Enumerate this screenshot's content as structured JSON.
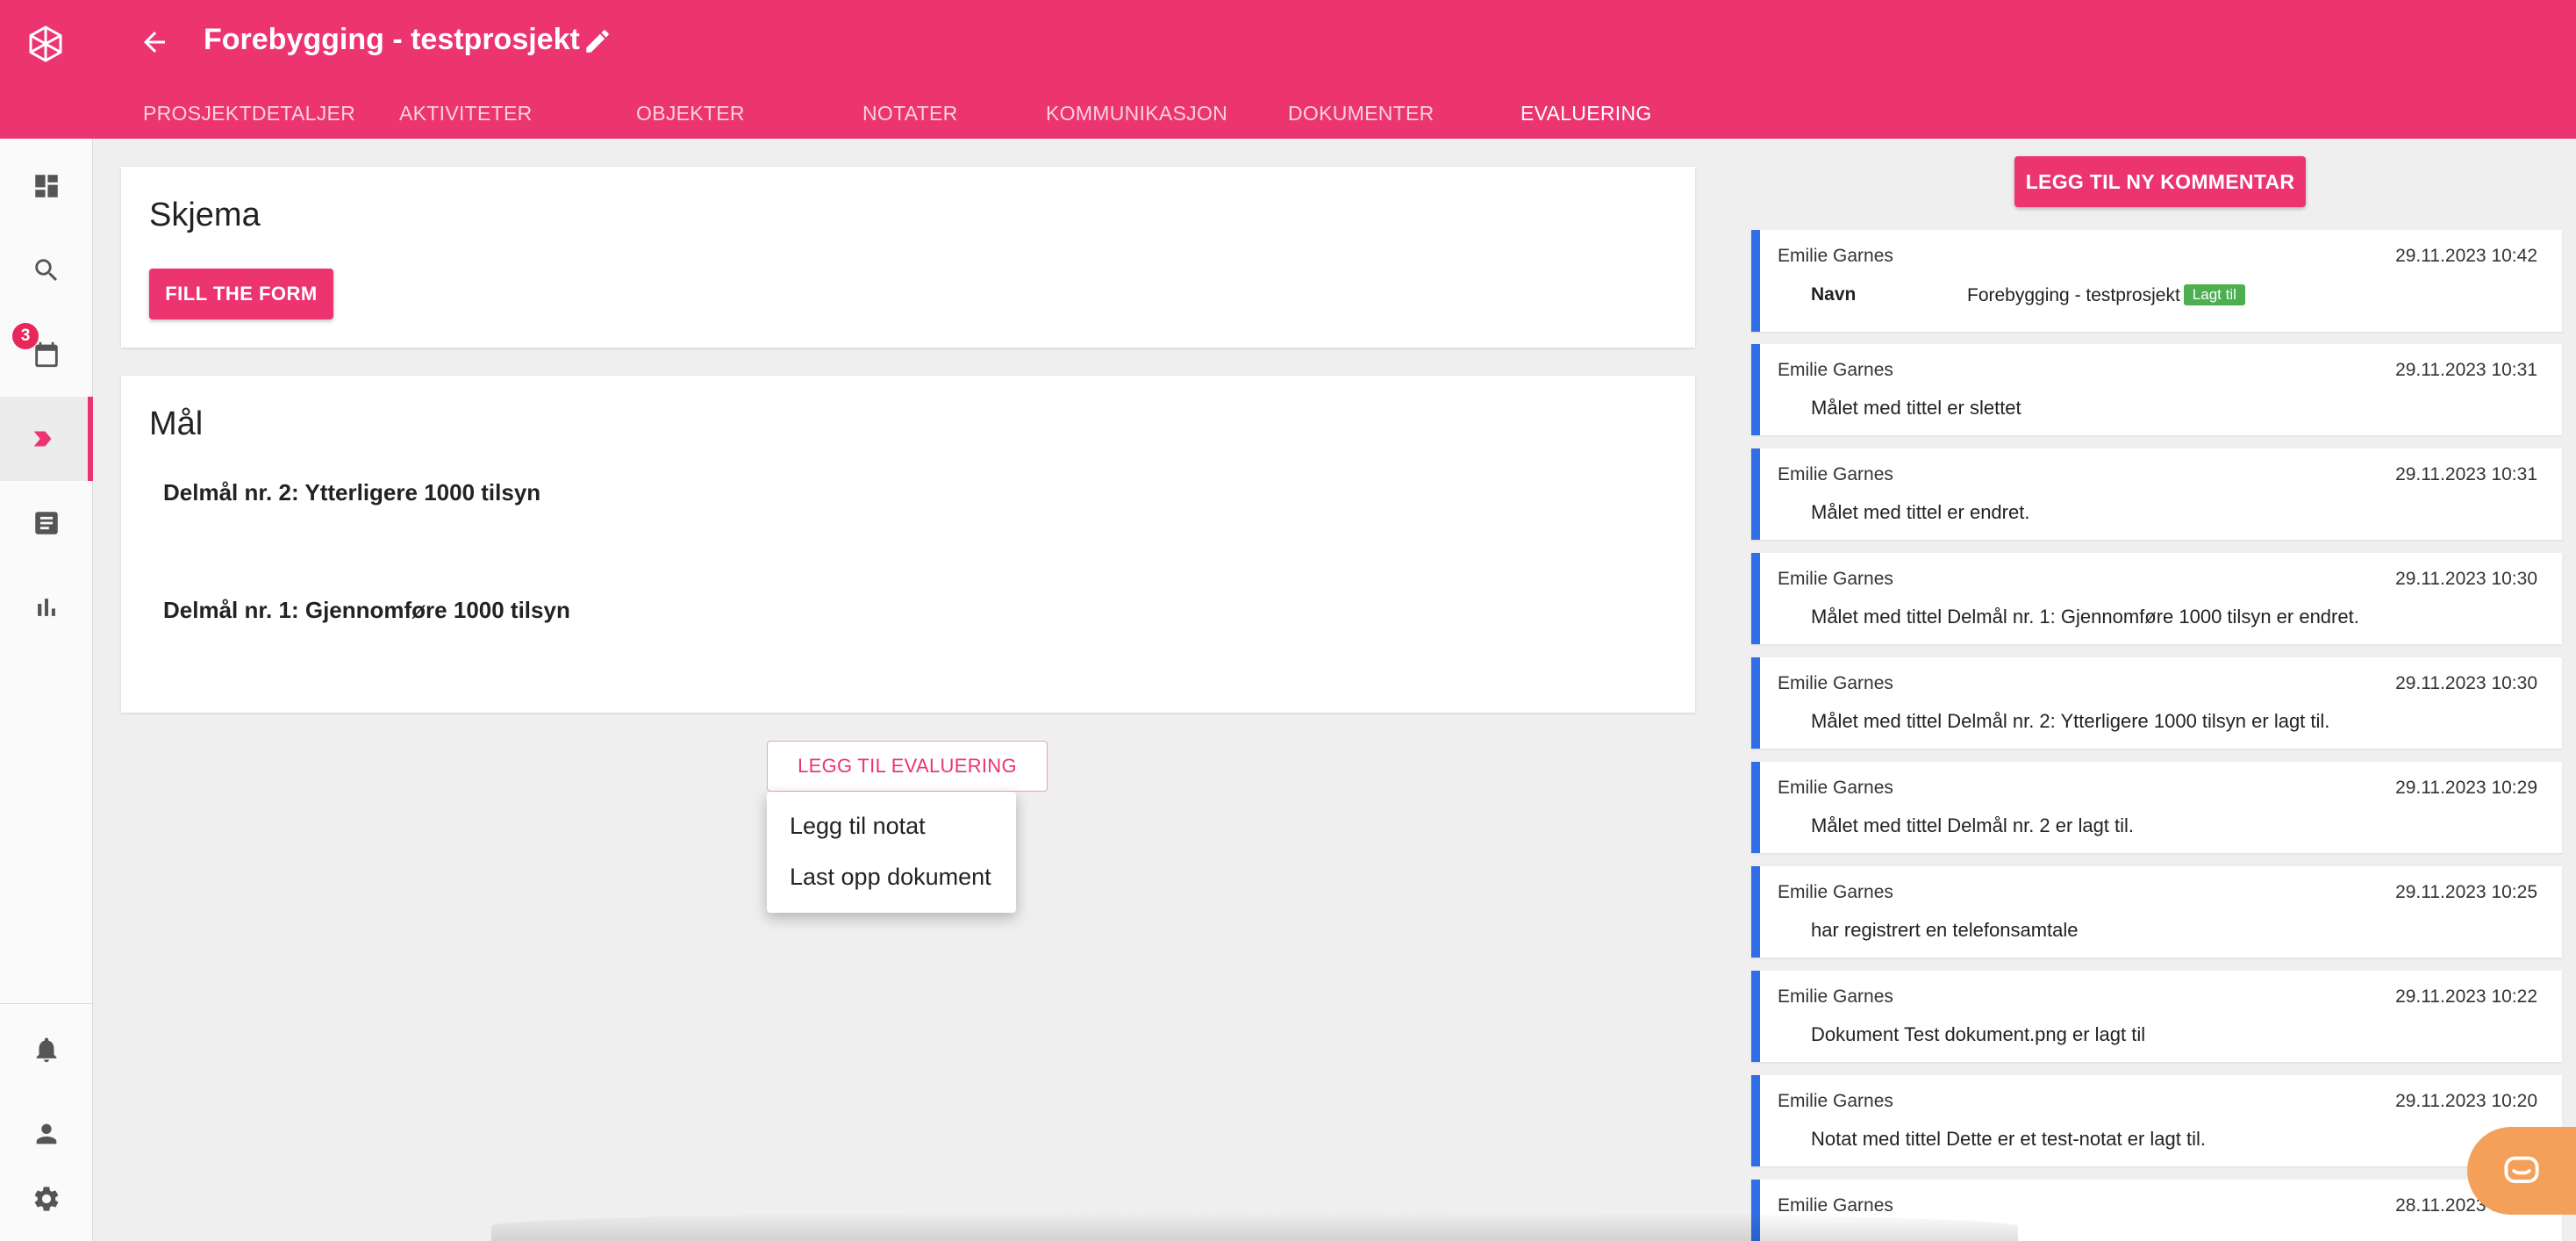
{
  "header": {
    "title": "Forebygging - testprosjekt",
    "tabs": [
      {
        "label": "PROSJEKTDETALJER"
      },
      {
        "label": "AKTIVITETER"
      },
      {
        "label": "OBJEKTER"
      },
      {
        "label": "NOTATER"
      },
      {
        "label": "KOMMUNIKASJON"
      },
      {
        "label": "DOKUMENTER"
      },
      {
        "label": "EVALUERING"
      }
    ],
    "active_tab": "EVALUERING"
  },
  "sidebar": {
    "items": [
      {
        "icon": "dashboard-icon"
      },
      {
        "icon": "search-icon"
      },
      {
        "icon": "calendar-icon",
        "badge": "3"
      },
      {
        "icon": "project-arrow-icon",
        "active": true
      },
      {
        "icon": "list-icon"
      },
      {
        "icon": "bar-chart-icon"
      },
      {
        "icon": "bell-icon"
      },
      {
        "icon": "person-icon"
      },
      {
        "icon": "gear-icon"
      }
    ]
  },
  "schema": {
    "title": "Skjema",
    "button": "FILL THE FORM"
  },
  "goals": {
    "title": "Mål",
    "items": [
      {
        "text": "Delmål nr. 2: Ytterligere 1000 tilsyn"
      },
      {
        "text": "Delmål nr. 1: Gjennomføre 1000 tilsyn"
      }
    ]
  },
  "evaluation": {
    "button": "LEGG TIL EVALUERING",
    "menu": [
      {
        "label": "Legg til notat"
      },
      {
        "label": "Last opp dokument"
      }
    ]
  },
  "comments": {
    "add_button": "LEGG TIL NY KOMMENTAR",
    "items": [
      {
        "author": "Emilie Garnes",
        "time": "29.11.2023 10:42",
        "key": "Navn",
        "value": "Forebygging - testprosjekt",
        "tag": "Lagt til"
      },
      {
        "author": "Emilie Garnes",
        "time": "29.11.2023 10:31",
        "text": "Målet med tittel  er slettet"
      },
      {
        "author": "Emilie Garnes",
        "time": "29.11.2023 10:31",
        "text": "Målet med tittel  er endret."
      },
      {
        "author": "Emilie Garnes",
        "time": "29.11.2023 10:30",
        "text": "Målet med tittel Delmål nr. 1: Gjennomføre 1000 tilsyn er endret."
      },
      {
        "author": "Emilie Garnes",
        "time": "29.11.2023 10:30",
        "text": "Målet med tittel Delmål nr. 2: Ytterligere 1000 tilsyn er lagt til."
      },
      {
        "author": "Emilie Garnes",
        "time": "29.11.2023 10:29",
        "text": "Målet med tittel Delmål nr. 2 er lagt til."
      },
      {
        "author": "Emilie Garnes",
        "time": "29.11.2023 10:25",
        "text": "har registrert en telefonsamtale"
      },
      {
        "author": "Emilie Garnes",
        "time": "29.11.2023 10:22",
        "text": "Dokument Test dokument.png er lagt til"
      },
      {
        "author": "Emilie Garnes",
        "time": "29.11.2023 10:20",
        "text": "Notat med tittel Dette er et test-notat er lagt til."
      },
      {
        "author": "Emilie Garnes",
        "time": "28.11.2023 15:47",
        "text": ""
      }
    ]
  },
  "colors": {
    "brand": "#ec3470",
    "comment_accent": "#2f6ee8",
    "tag_green": "#4caf50",
    "chat": "#f5a05a"
  }
}
